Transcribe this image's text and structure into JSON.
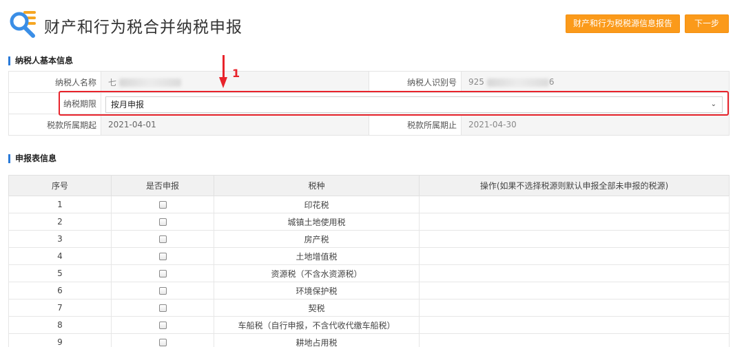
{
  "header": {
    "title": "财产和行为税合并纳税申报",
    "report_button": "财产和行为税税源信息报告",
    "next_button": "下一步"
  },
  "basic_info": {
    "section_title": "纳税人基本信息",
    "taxpayer_name_label": "纳税人名称",
    "taxpayer_name_value": "七",
    "taxpayer_id_label": "纳税人识别号",
    "taxpayer_id_value": "925",
    "taxpayer_id_suffix": "6",
    "period_label": "纳税期限",
    "period_value": "按月申报",
    "start_label": "税款所属期起",
    "start_value": "2021-04-01",
    "end_label": "税款所属期止",
    "end_value": "2021-04-30"
  },
  "annotation": {
    "label": "1",
    "color": "#e8232b"
  },
  "declaration": {
    "section_title": "申报表信息",
    "columns": [
      "序号",
      "是否申报",
      "税种",
      "操作(如果不选择税源则默认申报全部未申报的税源)"
    ],
    "rows": [
      {
        "no": "1",
        "tax": "印花税"
      },
      {
        "no": "2",
        "tax": "城镇土地使用税"
      },
      {
        "no": "3",
        "tax": "房产税"
      },
      {
        "no": "4",
        "tax": "土地增值税"
      },
      {
        "no": "5",
        "tax": "资源税（不含水资源税）"
      },
      {
        "no": "6",
        "tax": "环境保护税"
      },
      {
        "no": "7",
        "tax": "契税"
      },
      {
        "no": "8",
        "tax": "车船税（自行申报，不含代收代缴车船税）"
      },
      {
        "no": "9",
        "tax": "耕地占用税"
      }
    ]
  },
  "colors": {
    "accent": "#fb9a1a",
    "section_bar": "#2a7ad8",
    "highlight": "#e8232b"
  }
}
